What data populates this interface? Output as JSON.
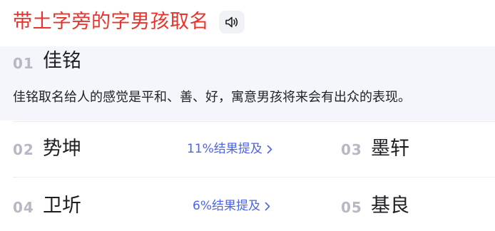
{
  "header": {
    "title": "带土字旁的字男孩取名",
    "sound_icon": "speaker-icon"
  },
  "top_entry": {
    "rank": "01",
    "name": "佳铭",
    "description": "佳铭取名给人的感觉是平和、善、好，寓意男孩将来会有出众的表现。"
  },
  "rows": [
    {
      "left": {
        "rank": "02",
        "name": "势坤"
      },
      "mention": "11%结果提及",
      "right": {
        "rank": "03",
        "name": "墨轩"
      }
    },
    {
      "left": {
        "rank": "04",
        "name": "卫圻"
      },
      "mention": "6%结果提及",
      "right": {
        "rank": "05",
        "name": "基良"
      }
    }
  ],
  "colors": {
    "title": "#e8332d",
    "mention": "#4e63e8",
    "rank": "#b6b9c3",
    "highlight_bg": "#f5f6fb"
  }
}
